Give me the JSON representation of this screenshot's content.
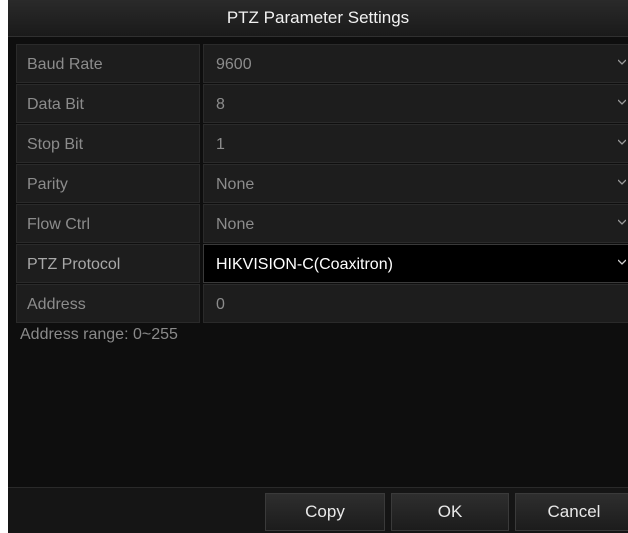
{
  "dialog": {
    "title": "PTZ Parameter Settings"
  },
  "fields": [
    {
      "label": "Baud Rate",
      "value": "9600"
    },
    {
      "label": "Data Bit",
      "value": "8"
    },
    {
      "label": "Stop Bit",
      "value": "1"
    },
    {
      "label": "Parity",
      "value": "None"
    },
    {
      "label": "Flow Ctrl",
      "value": "None"
    },
    {
      "label": "PTZ Protocol",
      "value": "HIKVISION-C(Coaxitron)"
    },
    {
      "label": "Address",
      "value": "0"
    }
  ],
  "note": "Address range: 0~255",
  "buttons": {
    "copy": "Copy",
    "ok": "OK",
    "cancel": "Cancel"
  },
  "icons": {
    "dropdown": "chevron-down-icon"
  }
}
